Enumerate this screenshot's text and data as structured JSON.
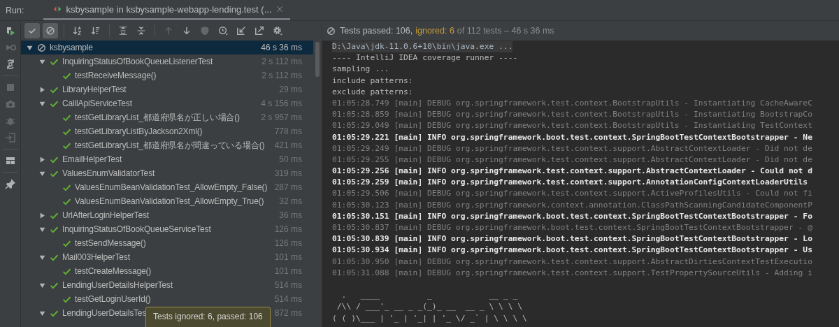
{
  "tab_bar": {
    "label": "Run:",
    "tab": {
      "title": "ksbysample in ksbysample-webapp-lending.test (...",
      "selected": true
    }
  },
  "sidebar": [
    {
      "disabled": false
    },
    {
      "disabled": true
    },
    {
      "disabled": false
    },
    {
      "disabled": true
    },
    {
      "disabled": true
    },
    {
      "disabled": true
    },
    {
      "disabled": true
    },
    {
      "disabled": false
    },
    {
      "disabled": false
    }
  ],
  "toolbar": [
    {
      "on": true,
      "disabled": false
    },
    {
      "on": true,
      "disabled": false
    },
    {
      "on": false,
      "disabled": false
    },
    {
      "on": false,
      "disabled": false
    },
    {
      "on": false,
      "disabled": false
    },
    {
      "on": false,
      "disabled": false
    },
    {
      "on": false,
      "disabled": true
    },
    {
      "on": false,
      "disabled": false
    },
    {
      "on": false,
      "disabled": true
    },
    {
      "on": false,
      "disabled": false
    },
    {
      "on": false,
      "disabled": false
    },
    {
      "on": false,
      "disabled": false
    },
    {
      "on": false,
      "disabled": false
    }
  ],
  "status": {
    "passed": "Tests passed: 106,",
    "ignored": "ignored: 6",
    "rest": "of 112 tests – 46 s 36 ms"
  },
  "tree": [
    {
      "name": "ksbysample",
      "ignored": true,
      "duration": "46 s 36 ms",
      "selected": true,
      "expanded": true,
      "children": [
        {
          "name": "InquiringStatusOfBookQueueListenerTest",
          "ignored": false,
          "duration": "2 s 112 ms",
          "selected": false,
          "expanded": true,
          "children": [
            {
              "name": "testReceiveMessage()",
              "ignored": false,
              "duration": "2 s 112 ms",
              "selected": false
            }
          ]
        },
        {
          "name": "LibraryHelperTest",
          "ignored": false,
          "duration": "29 ms",
          "selected": false,
          "expanded": false
        },
        {
          "name": "CalilApiServiceTest",
          "ignored": false,
          "duration": "4 s 156 ms",
          "selected": false,
          "expanded": true,
          "children": [
            {
              "name": "testGetLibraryList_都道府県名が正しい場合()",
              "ignored": false,
              "duration": "2 s 957 ms",
              "selected": false
            },
            {
              "name": "testGetLibraryListByJackson2Xml()",
              "ignored": false,
              "duration": "778 ms",
              "selected": false
            },
            {
              "name": "testGetLibraryList_都道府県名が間違っている場合()",
              "ignored": false,
              "duration": "421 ms",
              "selected": false
            }
          ]
        },
        {
          "name": "EmailHelperTest",
          "ignored": false,
          "duration": "50 ms",
          "selected": false,
          "expanded": false
        },
        {
          "name": "ValuesEnumValidatorTest",
          "ignored": false,
          "duration": "319 ms",
          "selected": false,
          "expanded": true,
          "children": [
            {
              "name": "ValuesEnumBeanValidationTest_AllowEmpty_False()",
              "ignored": false,
              "duration": "287 ms",
              "selected": false
            },
            {
              "name": "ValuesEnumBeanValidationTest_AllowEmpty_True()",
              "ignored": false,
              "duration": "32 ms",
              "selected": false
            }
          ]
        },
        {
          "name": "UrlAfterLoginHelperTest",
          "ignored": false,
          "duration": "36 ms",
          "selected": false,
          "expanded": false
        },
        {
          "name": "InquiringStatusOfBookQueueServiceTest",
          "ignored": false,
          "duration": "126 ms",
          "selected": false,
          "expanded": true,
          "children": [
            {
              "name": "testSendMessage()",
              "ignored": false,
              "duration": "126 ms",
              "selected": false
            }
          ]
        },
        {
          "name": "Mail003HelperTest",
          "ignored": false,
          "duration": "101 ms",
          "selected": false,
          "expanded": true,
          "children": [
            {
              "name": "testCreateMessage()",
              "ignored": false,
              "duration": "101 ms",
              "selected": false
            }
          ]
        },
        {
          "name": "LendingUserDetailsHelperTest",
          "ignored": false,
          "duration": "514 ms",
          "selected": false,
          "expanded": true,
          "children": [
            {
              "name": "testGetLoginUserId()",
              "ignored": false,
              "duration": "514 ms",
              "selected": false
            }
          ]
        },
        {
          "name": "LendingUserDetailsTes",
          "ignored": false,
          "duration": "872 ms",
          "selected": false,
          "expanded": true
        }
      ]
    }
  ],
  "tooltip": "Tests ignored: 6, passed: 106",
  "console": [
    {
      "kind": "command",
      "text": "D:\\Java\\jdk-11.0.6+10\\bin\\java.exe ..."
    },
    {
      "kind": "plain",
      "text": "---- IntelliJ IDEA coverage runner ----"
    },
    {
      "kind": "plain",
      "text": "sampling ..."
    },
    {
      "kind": "plain",
      "text": "include patterns:"
    },
    {
      "kind": "plain",
      "text": "exclude patterns:"
    },
    {
      "kind": "debug",
      "text": "01:05:28.749 [main] DEBUG org.springframework.test.context.BootstrapUtils - Instantiating CacheAwareC"
    },
    {
      "kind": "debug",
      "text": "01:05:28.859 [main] DEBUG org.springframework.test.context.BootstrapUtils - Instantiating BootstrapCo"
    },
    {
      "kind": "debug",
      "text": "01:05:29.049 [main] DEBUG org.springframework.test.context.BootstrapUtils - Instantiating TestContext"
    },
    {
      "kind": "info",
      "text": "01:05:29.221 [main] INFO org.springframework.boot.test.context.SpringBootTestContextBootstrapper - Ne"
    },
    {
      "kind": "debug",
      "text": "01:05:29.249 [main] DEBUG org.springframework.test.context.support.AbstractContextLoader - Did not de"
    },
    {
      "kind": "debug",
      "text": "01:05:29.255 [main] DEBUG org.springframework.test.context.support.AbstractContextLoader - Did not de"
    },
    {
      "kind": "info",
      "text": "01:05:29.256 [main] INFO org.springframework.test.context.support.AbstractContextLoader - Could not d"
    },
    {
      "kind": "info",
      "text": "01:05:29.259 [main] INFO org.springframework.test.context.support.AnnotationConfigContextLoaderUtils"
    },
    {
      "kind": "debug",
      "text": "01:05:29.506 [main] DEBUG org.springframework.test.context.support.ActiveProfilesUtils - Could not fi"
    },
    {
      "kind": "debug",
      "text": "01:05:30.123 [main] DEBUG org.springframework.context.annotation.ClassPathScanningCandidateComponentP"
    },
    {
      "kind": "info",
      "text": "01:05:30.151 [main] INFO org.springframework.boot.test.context.SpringBootTestContextBootstrapper - Fo"
    },
    {
      "kind": "debug",
      "text": "01:05:30.837 [main] DEBUG org.springframework.boot.test.context.SpringBootTestContextBootstrapper - @"
    },
    {
      "kind": "info",
      "text": "01:05:30.839 [main] INFO org.springframework.boot.test.context.SpringBootTestContextBootstrapper - Lo"
    },
    {
      "kind": "info",
      "text": "01:05:30.934 [main] INFO org.springframework.boot.test.context.SpringBootTestContextBootstrapper - Us"
    },
    {
      "kind": "debug",
      "text": "01:05:30.950 [main] DEBUG org.springframework.test.context.support.AbstractDirtiesContextTestExecutio"
    },
    {
      "kind": "debug",
      "text": "01:05:31.088 [main] DEBUG org.springframework.test.context.support.TestPropertySourceUtils - Adding i"
    },
    {
      "kind": "gap"
    },
    {
      "kind": "plain",
      "text": "  .   ____          _            __ _ _"
    },
    {
      "kind": "plain",
      "text": " /\\\\ / ___'_ __ _ _(_)_ __  __ _ \\ \\ \\ \\"
    },
    {
      "kind": "plain",
      "text": "( ( )\\___ | '_ | '_| | '_ \\/ _` | \\ \\ \\ \\"
    }
  ]
}
